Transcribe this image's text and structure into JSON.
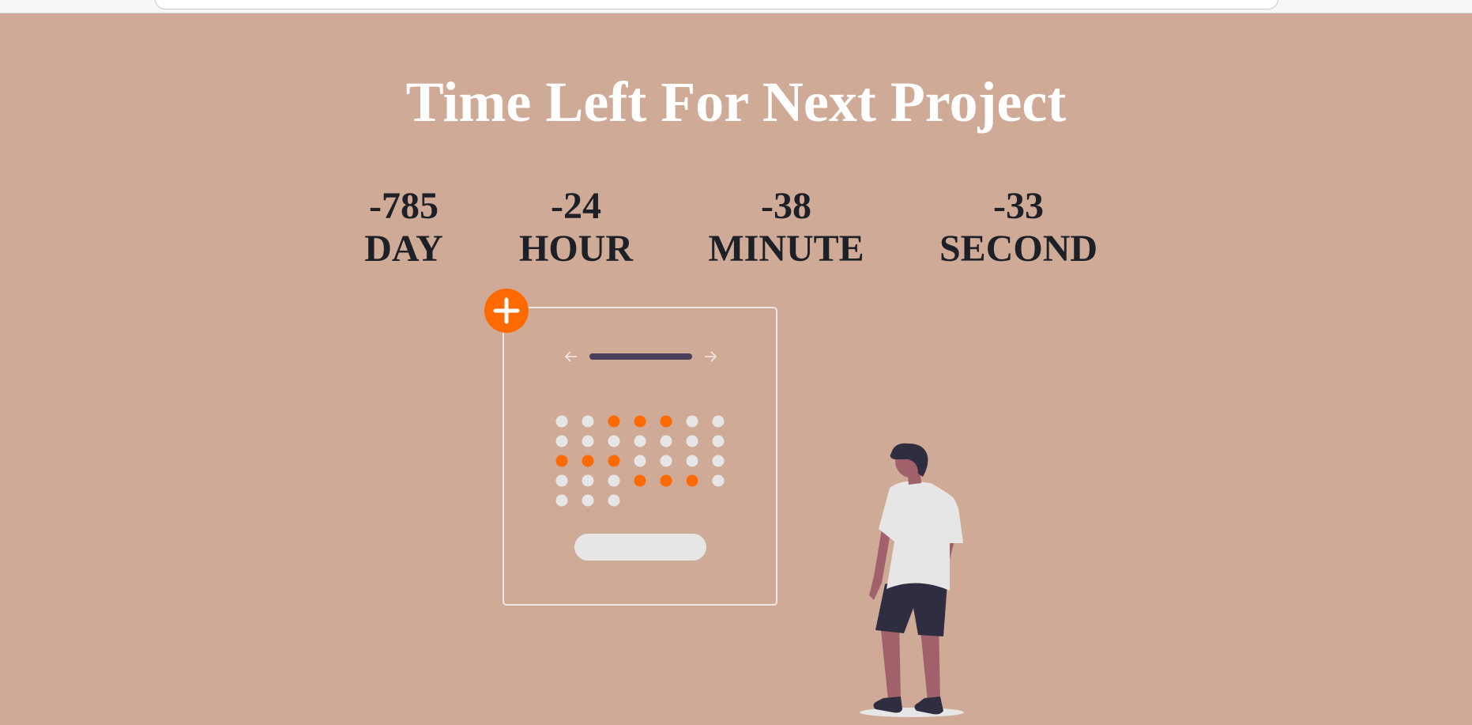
{
  "page": {
    "title": "Time Left For Next Project",
    "background": "#cfab97",
    "accent": "#ff6a00"
  },
  "countdown": [
    {
      "value": "-785",
      "label": "DAY"
    },
    {
      "value": "-24",
      "label": "HOUR"
    },
    {
      "value": "-38",
      "label": "MINUTE"
    },
    {
      "value": "-33",
      "label": "SECOND"
    }
  ],
  "illustration": {
    "calendar_icons": [
      "add-icon",
      "arrow-left-icon",
      "arrow-right-icon"
    ],
    "highlighted_day_color": "#ff6a00",
    "default_day_color": "#e6e6e6"
  }
}
